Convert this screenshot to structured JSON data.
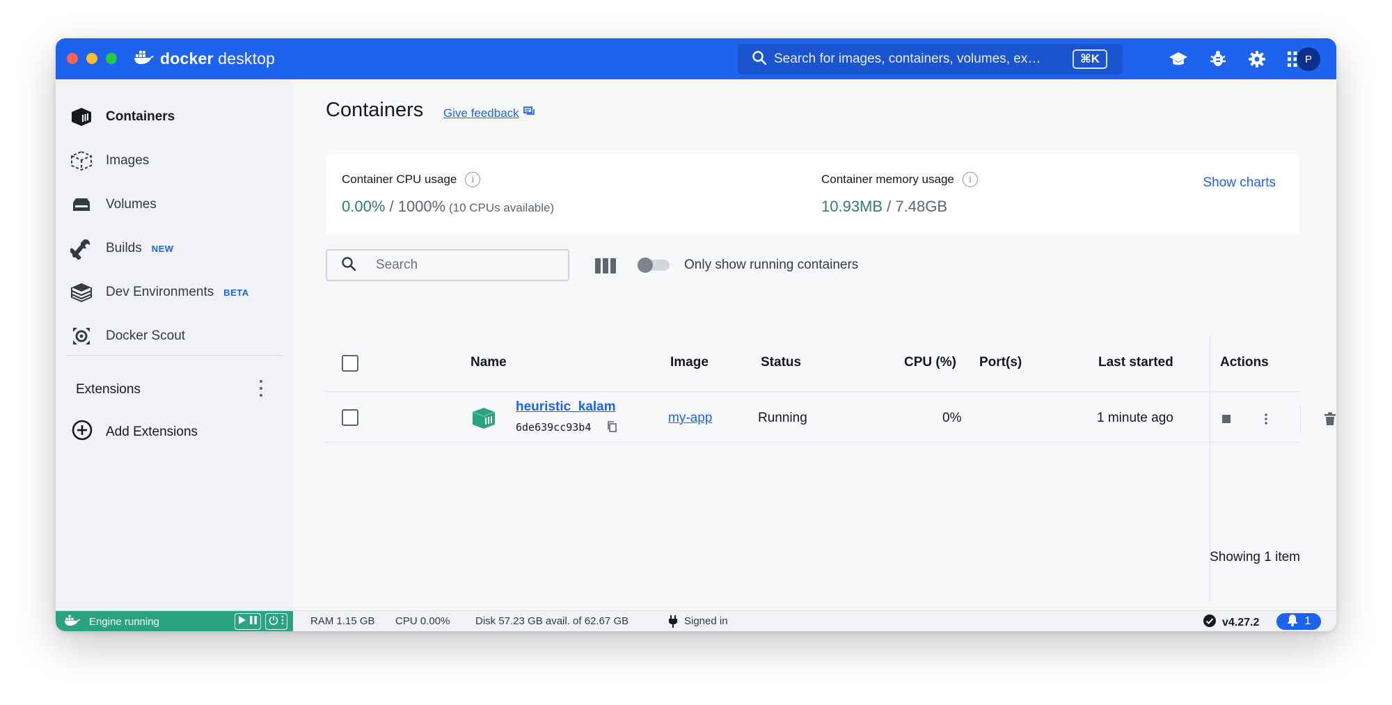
{
  "app": {
    "brand_bold": "docker",
    "brand_rest": "desktop"
  },
  "titlebar": {
    "search_placeholder": "Search for images, containers, volumes, ex…",
    "shortcut": "⌘K",
    "avatar_initial": "P",
    "icons": [
      "learning-center-icon",
      "bug-icon",
      "gear-icon",
      "grid-apps-icon"
    ]
  },
  "sidebar": {
    "items": [
      {
        "label": "Containers",
        "icon": "container-icon",
        "active": true,
        "badge": ""
      },
      {
        "label": "Images",
        "icon": "image-icon",
        "active": false,
        "badge": ""
      },
      {
        "label": "Volumes",
        "icon": "volume-icon",
        "active": false,
        "badge": ""
      },
      {
        "label": "Builds",
        "icon": "wrench-icon",
        "active": false,
        "badge": "NEW"
      },
      {
        "label": "Dev Environments",
        "icon": "dev-env-icon",
        "active": false,
        "badge": "BETA"
      },
      {
        "label": "Docker Scout",
        "icon": "scout-icon",
        "active": false,
        "badge": ""
      }
    ],
    "extensions_title": "Extensions",
    "add_extensions": "Add Extensions"
  },
  "main": {
    "title": "Containers",
    "feedback": "Give feedback",
    "stats": {
      "cpu_label": "Container CPU usage",
      "cpu_value": "0.00%",
      "cpu_sep": " / 1000%",
      "cpu_note": " (10 CPUs available)",
      "mem_label": "Container memory usage",
      "mem_value": "10.93MB",
      "mem_sep": " / 7.48GB",
      "show_charts": "Show charts"
    },
    "search_placeholder": "Search",
    "toggle_label": "Only show running containers",
    "toggle_on": false,
    "table": {
      "headers": [
        "Name",
        "Image",
        "Status",
        "CPU (%)",
        "Port(s)",
        "Last started",
        "Actions"
      ],
      "rows": [
        {
          "name": "heuristic_kalam",
          "id": "6de639cc93b4",
          "image": "my-app",
          "status": "Running",
          "cpu": "0%",
          "ports": "",
          "last_started": "1 minute ago"
        }
      ]
    },
    "showing": "Showing 1 item"
  },
  "footer": {
    "engine": "Engine running",
    "ram": "RAM 1.15 GB",
    "cpu": "CPU 0.00%",
    "disk": "Disk 57.23 GB avail. of 62.67 GB",
    "signed": "Signed in",
    "version": "v4.27.2",
    "notifications": "1"
  },
  "colors": {
    "brand_blue": "#1d63ed",
    "engine_green": "#2aa37f",
    "container_teal": "#2aa37f",
    "stat_green": "#2f7d72"
  }
}
